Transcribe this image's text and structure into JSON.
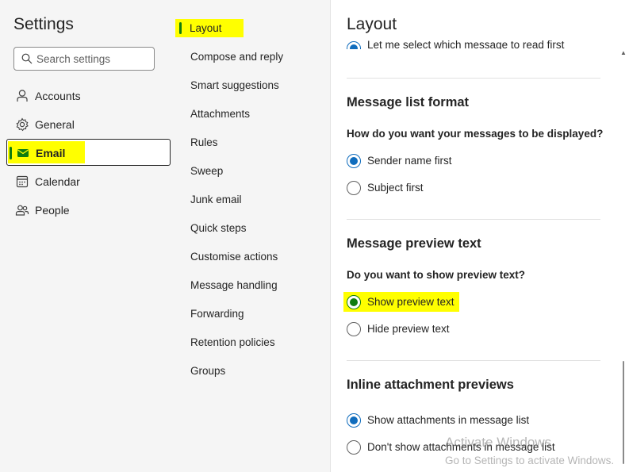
{
  "settings_title": "Settings",
  "search": {
    "placeholder": "Search settings"
  },
  "nav_main": [
    {
      "label": "Accounts",
      "icon": "person-icon"
    },
    {
      "label": "General",
      "icon": "gear-icon"
    },
    {
      "label": "Email",
      "icon": "mail-icon",
      "selected": true
    },
    {
      "label": "Calendar",
      "icon": "calendar-icon"
    },
    {
      "label": "People",
      "icon": "people-icon"
    }
  ],
  "nav_email": {
    "selected": "Layout",
    "items": [
      "Compose and reply",
      "Smart suggestions",
      "Attachments",
      "Rules",
      "Sweep",
      "Junk email",
      "Quick steps",
      "Customise actions",
      "Message handling",
      "Forwarding",
      "Retention policies",
      "Groups"
    ]
  },
  "pane": {
    "title": "Layout",
    "partial_option": "Let me select which message to read first",
    "sections": [
      {
        "title": "Message list format",
        "question": "How do you want your messages to be displayed?",
        "options": [
          {
            "label": "Sender name first",
            "selected": true
          },
          {
            "label": "Subject first",
            "selected": false
          }
        ]
      },
      {
        "title": "Message preview text",
        "question": "Do you want to show preview text?",
        "options": [
          {
            "label": "Show preview text",
            "selected": true,
            "highlighted": true
          },
          {
            "label": "Hide preview text",
            "selected": false
          }
        ]
      },
      {
        "title": "Inline attachment previews",
        "options": [
          {
            "label": "Show attachments in message list",
            "selected": true
          },
          {
            "label": "Don't show attachments in message list",
            "selected": false
          }
        ]
      }
    ]
  },
  "watermark": {
    "line1": "Activate Windows",
    "line2": "Go to Settings to activate Windows."
  },
  "colors": {
    "accent": "#0f6cbd",
    "highlight": "#ffff00",
    "selection_bar": "#107c10"
  }
}
